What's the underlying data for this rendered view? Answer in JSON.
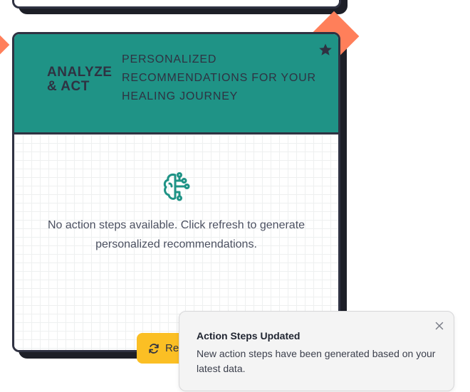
{
  "card": {
    "title": "ANALYZE & ACT",
    "subtitle": "Personalized recommendations for your healing journey",
    "empty_message": "No action steps available. Click refresh to generate personalized recommendations.",
    "header_color": "#1f9386"
  },
  "refresh_button": {
    "label": "Re",
    "icon": "refresh-icon",
    "color": "#fbbf24"
  },
  "toast": {
    "title": "Action Steps Updated",
    "message": "New action steps have been generated based on your latest data.",
    "close_icon": "close-icon"
  },
  "colors": {
    "accent": "#ff7f5a",
    "border": "#2f3242"
  }
}
